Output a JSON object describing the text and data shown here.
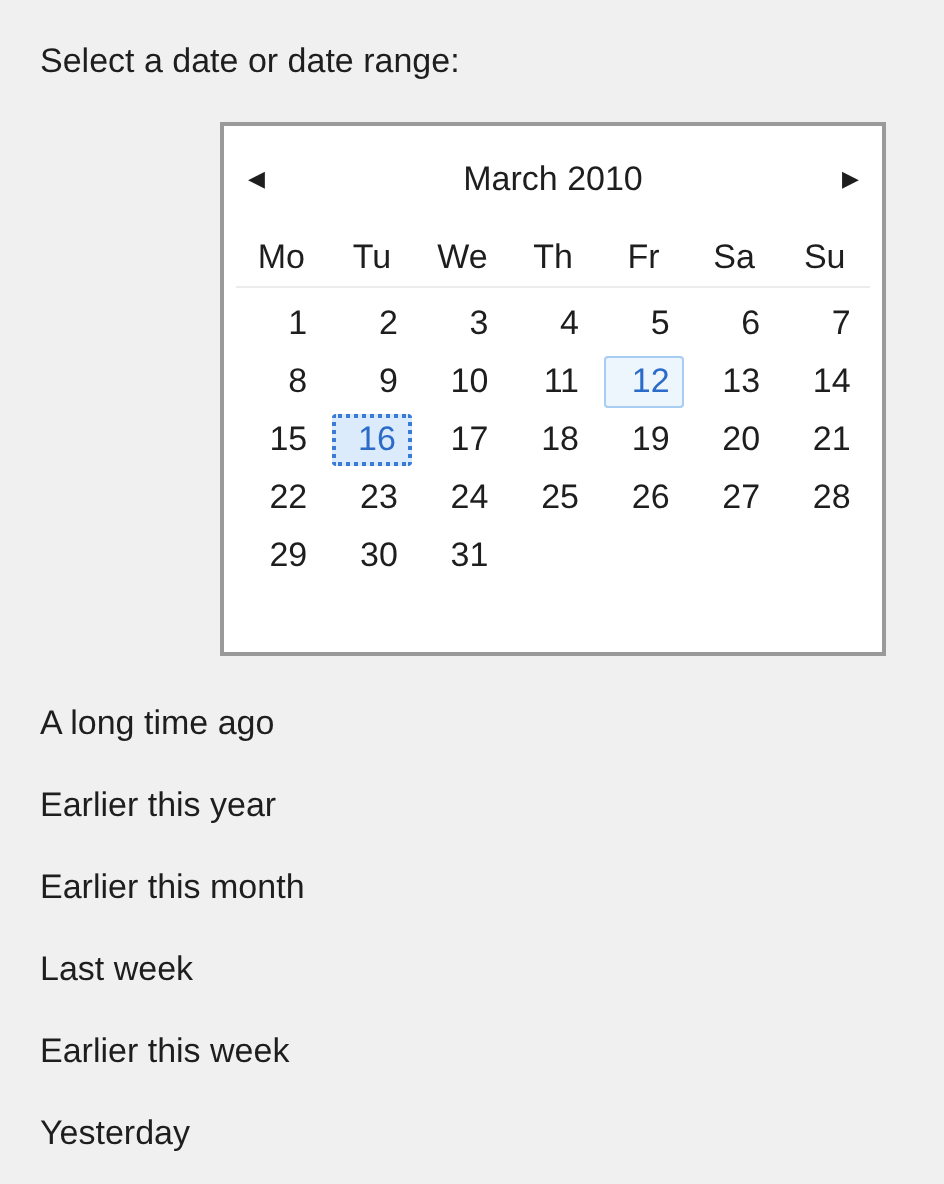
{
  "prompt": "Select a date or date range:",
  "calendar": {
    "month": "March 2010",
    "prev": "◀",
    "next": "▶",
    "weekdays": [
      "Mo",
      "Tu",
      "We",
      "Th",
      "Fr",
      "Sa",
      "Su"
    ],
    "weeks": [
      [
        {
          "day": "1",
          "selected": false,
          "today": false
        },
        {
          "day": "2",
          "selected": false,
          "today": false
        },
        {
          "day": "3",
          "selected": false,
          "today": false
        },
        {
          "day": "4",
          "selected": false,
          "today": false
        },
        {
          "day": "5",
          "selected": false,
          "today": false
        },
        {
          "day": "6",
          "selected": false,
          "today": false
        },
        {
          "day": "7",
          "selected": false,
          "today": false
        }
      ],
      [
        {
          "day": "8",
          "selected": false,
          "today": false
        },
        {
          "day": "9",
          "selected": false,
          "today": false
        },
        {
          "day": "10",
          "selected": false,
          "today": false
        },
        {
          "day": "11",
          "selected": false,
          "today": false
        },
        {
          "day": "12",
          "selected": false,
          "today": true
        },
        {
          "day": "13",
          "selected": false,
          "today": false
        },
        {
          "day": "14",
          "selected": false,
          "today": false
        }
      ],
      [
        {
          "day": "15",
          "selected": false,
          "today": false
        },
        {
          "day": "16",
          "selected": true,
          "today": false
        },
        {
          "day": "17",
          "selected": false,
          "today": false
        },
        {
          "day": "18",
          "selected": false,
          "today": false
        },
        {
          "day": "19",
          "selected": false,
          "today": false
        },
        {
          "day": "20",
          "selected": false,
          "today": false
        },
        {
          "day": "21",
          "selected": false,
          "today": false
        }
      ],
      [
        {
          "day": "22",
          "selected": false,
          "today": false
        },
        {
          "day": "23",
          "selected": false,
          "today": false
        },
        {
          "day": "24",
          "selected": false,
          "today": false
        },
        {
          "day": "25",
          "selected": false,
          "today": false
        },
        {
          "day": "26",
          "selected": false,
          "today": false
        },
        {
          "day": "27",
          "selected": false,
          "today": false
        },
        {
          "day": "28",
          "selected": false,
          "today": false
        }
      ],
      [
        {
          "day": "29",
          "selected": false,
          "today": false
        },
        {
          "day": "30",
          "selected": false,
          "today": false
        },
        {
          "day": "31",
          "selected": false,
          "today": false
        }
      ]
    ]
  },
  "ranges": [
    "A long time ago",
    "Earlier this year",
    "Earlier this month",
    "Last week",
    "Earlier this week",
    "Yesterday"
  ]
}
